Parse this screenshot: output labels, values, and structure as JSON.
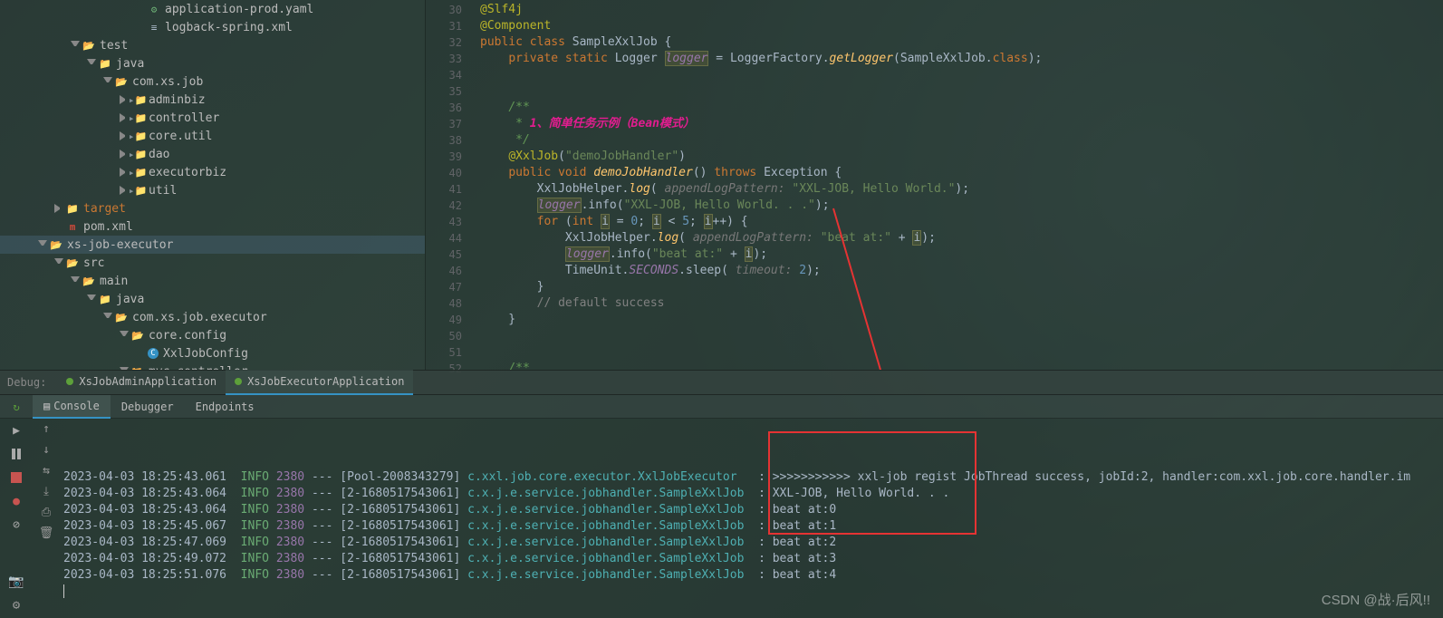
{
  "tree": [
    {
      "indent": 150,
      "arrow": "",
      "icon": "yaml",
      "label": "application-prod.yaml"
    },
    {
      "indent": 150,
      "arrow": "",
      "icon": "xml",
      "label": "logback-spring.xml"
    },
    {
      "indent": 78,
      "arrow": "down",
      "icon": "folder-open",
      "label": "test"
    },
    {
      "indent": 96,
      "arrow": "down",
      "icon": "java-folder",
      "label": "java"
    },
    {
      "indent": 114,
      "arrow": "down",
      "icon": "folder-open",
      "label": "com.xs.job"
    },
    {
      "indent": 132,
      "arrow": "right",
      "icon": "folder",
      "label": "adminbiz"
    },
    {
      "indent": 132,
      "arrow": "right",
      "icon": "folder",
      "label": "controller"
    },
    {
      "indent": 132,
      "arrow": "right",
      "icon": "folder",
      "label": "core.util"
    },
    {
      "indent": 132,
      "arrow": "right",
      "icon": "folder",
      "label": "dao"
    },
    {
      "indent": 132,
      "arrow": "right",
      "icon": "folder",
      "label": "executorbiz"
    },
    {
      "indent": 132,
      "arrow": "right",
      "icon": "folder",
      "label": "util"
    },
    {
      "indent": 60,
      "arrow": "right",
      "icon": "target",
      "label": "target",
      "excluded": true
    },
    {
      "indent": 60,
      "arrow": "",
      "icon": "maven",
      "label": "pom.xml"
    },
    {
      "indent": 42,
      "arrow": "down",
      "icon": "folder-open",
      "label": "xs-job-executor",
      "selected": true
    },
    {
      "indent": 60,
      "arrow": "down",
      "icon": "folder-open",
      "label": "src"
    },
    {
      "indent": 78,
      "arrow": "down",
      "icon": "folder-open",
      "label": "main"
    },
    {
      "indent": 96,
      "arrow": "down",
      "icon": "java-folder",
      "label": "java"
    },
    {
      "indent": 114,
      "arrow": "down",
      "icon": "folder-open",
      "label": "com.xs.job.executor"
    },
    {
      "indent": 132,
      "arrow": "down",
      "icon": "folder-open",
      "label": "core.config"
    },
    {
      "indent": 150,
      "arrow": "",
      "icon": "class",
      "label": "XxlJobConfig"
    },
    {
      "indent": 132,
      "arrow": "down",
      "icon": "folder-open",
      "label": "mvc.controller"
    }
  ],
  "gutter_start": 30,
  "gutter_count": 23,
  "code_lines": [
    {
      "n": 30,
      "html": "<span class='ann'>@Slf4j</span>"
    },
    {
      "n": 31,
      "html": "<span class='ann'>@Component</span>",
      "runIcon": true
    },
    {
      "n": 32,
      "html": "<span class='kw'>public class</span> <span class='class-name'>SampleXxlJob</span> {"
    },
    {
      "n": 33,
      "html": "    <span class='kw'>private static</span> Logger <span class='field hl'>logger</span> = LoggerFactory.<span class='static-call'>getLogger</span>(SampleXxlJob.<span class='kw'>class</span>);"
    },
    {
      "n": 34,
      "html": ""
    },
    {
      "n": 35,
      "html": ""
    },
    {
      "n": 36,
      "html": "    <span class='doc'>/**</span>"
    },
    {
      "n": 37,
      "html": "    <span class='doc'> * </span><span class='doc-em'>1、简单任务示例（Bean模式）</span>"
    },
    {
      "n": 38,
      "html": "    <span class='doc'> */</span>"
    },
    {
      "n": 39,
      "html": "    <span class='ann'>@XxlJob</span>(<span class='str'>\"demoJobHandler\"</span>)"
    },
    {
      "n": 40,
      "html": "    <span class='kw'>public void</span> <span class='method-call'>demoJobHandler</span>() <span class='kw'>throws</span> Exception {"
    },
    {
      "n": 41,
      "html": "        XxlJobHelper.<span class='static-call'>log</span>( <span class='param-hint'>appendLogPattern:</span> <span class='str'>\"XXL-JOB, Hello World.\"</span>);"
    },
    {
      "n": 42,
      "html": "        <span class='field hl'>logger</span>.info(<span class='str'>\"XXL-JOB, Hello World. . .\"</span>);"
    },
    {
      "n": 43,
      "html": "        <span class='kw'>for</span> (<span class='kw'>int</span> <span class='hl'>i</span> = <span class='num'>0</span>; <span class='hl'>i</span> &lt; <span class='num'>5</span>; <span class='hl'>i</span>++) {"
    },
    {
      "n": 44,
      "html": "            XxlJobHelper.<span class='static-call'>log</span>( <span class='param-hint'>appendLogPattern:</span> <span class='str'>\"beat at:\"</span> + <span class='hl'>i</span>);"
    },
    {
      "n": 45,
      "html": "            <span class='field hl'>logger</span>.info(<span class='str'>\"beat at:\"</span> + <span class='hl'>i</span>);"
    },
    {
      "n": 46,
      "html": "            TimeUnit.<span class='field'>SECONDS</span>.sleep( <span class='param-hint'>timeout:</span> <span class='num'>2</span>);"
    },
    {
      "n": 47,
      "html": "        }"
    },
    {
      "n": 48,
      "html": "        <span class='cmt'>// default success</span>"
    },
    {
      "n": 49,
      "html": "    }"
    },
    {
      "n": 50,
      "html": ""
    },
    {
      "n": 51,
      "html": ""
    },
    {
      "n": 52,
      "html": "    <span class='doc'>/**</span>"
    }
  ],
  "debug": {
    "label": "Debug:",
    "tabs": [
      {
        "label": "XsJobAdminApplication",
        "active": false
      },
      {
        "label": "XsJobExecutorApplication",
        "active": true
      }
    ]
  },
  "tool_tabs": [
    "Console",
    "Debugger",
    "Endpoints"
  ],
  "active_tool_tab": 0,
  "log_lines": [
    {
      "ts": "2023-04-03 18:25:43.061",
      "lvl": "INFO",
      "pid": "2380",
      "thread": "[Pool-2008343279]",
      "logger": "c.xxl.job.core.executor.XxlJobExecutor",
      "msg": ": >>>>>>>>>>> xxl-job regist JobThread success, jobId:2, handler:com.xxl.job.core.handler.im"
    },
    {
      "ts": "2023-04-03 18:25:43.064",
      "lvl": "INFO",
      "pid": "2380",
      "thread": "[2-1680517543061]",
      "logger": "c.x.j.e.service.jobhandler.SampleXxlJob",
      "msg": ": XXL-JOB, Hello World. . ."
    },
    {
      "ts": "2023-04-03 18:25:43.064",
      "lvl": "INFO",
      "pid": "2380",
      "thread": "[2-1680517543061]",
      "logger": "c.x.j.e.service.jobhandler.SampleXxlJob",
      "msg": ": beat at:0"
    },
    {
      "ts": "2023-04-03 18:25:45.067",
      "lvl": "INFO",
      "pid": "2380",
      "thread": "[2-1680517543061]",
      "logger": "c.x.j.e.service.jobhandler.SampleXxlJob",
      "msg": ": beat at:1"
    },
    {
      "ts": "2023-04-03 18:25:47.069",
      "lvl": "INFO",
      "pid": "2380",
      "thread": "[2-1680517543061]",
      "logger": "c.x.j.e.service.jobhandler.SampleXxlJob",
      "msg": ": beat at:2"
    },
    {
      "ts": "2023-04-03 18:25:49.072",
      "lvl": "INFO",
      "pid": "2380",
      "thread": "[2-1680517543061]",
      "logger": "c.x.j.e.service.jobhandler.SampleXxlJob",
      "msg": ": beat at:3"
    },
    {
      "ts": "2023-04-03 18:25:51.076",
      "lvl": "INFO",
      "pid": "2380",
      "thread": "[2-1680517543061]",
      "logger": "c.x.j.e.service.jobhandler.SampleXxlJob",
      "msg": ": beat at:4"
    }
  ],
  "watermark": "CSDN @战·后风!!"
}
